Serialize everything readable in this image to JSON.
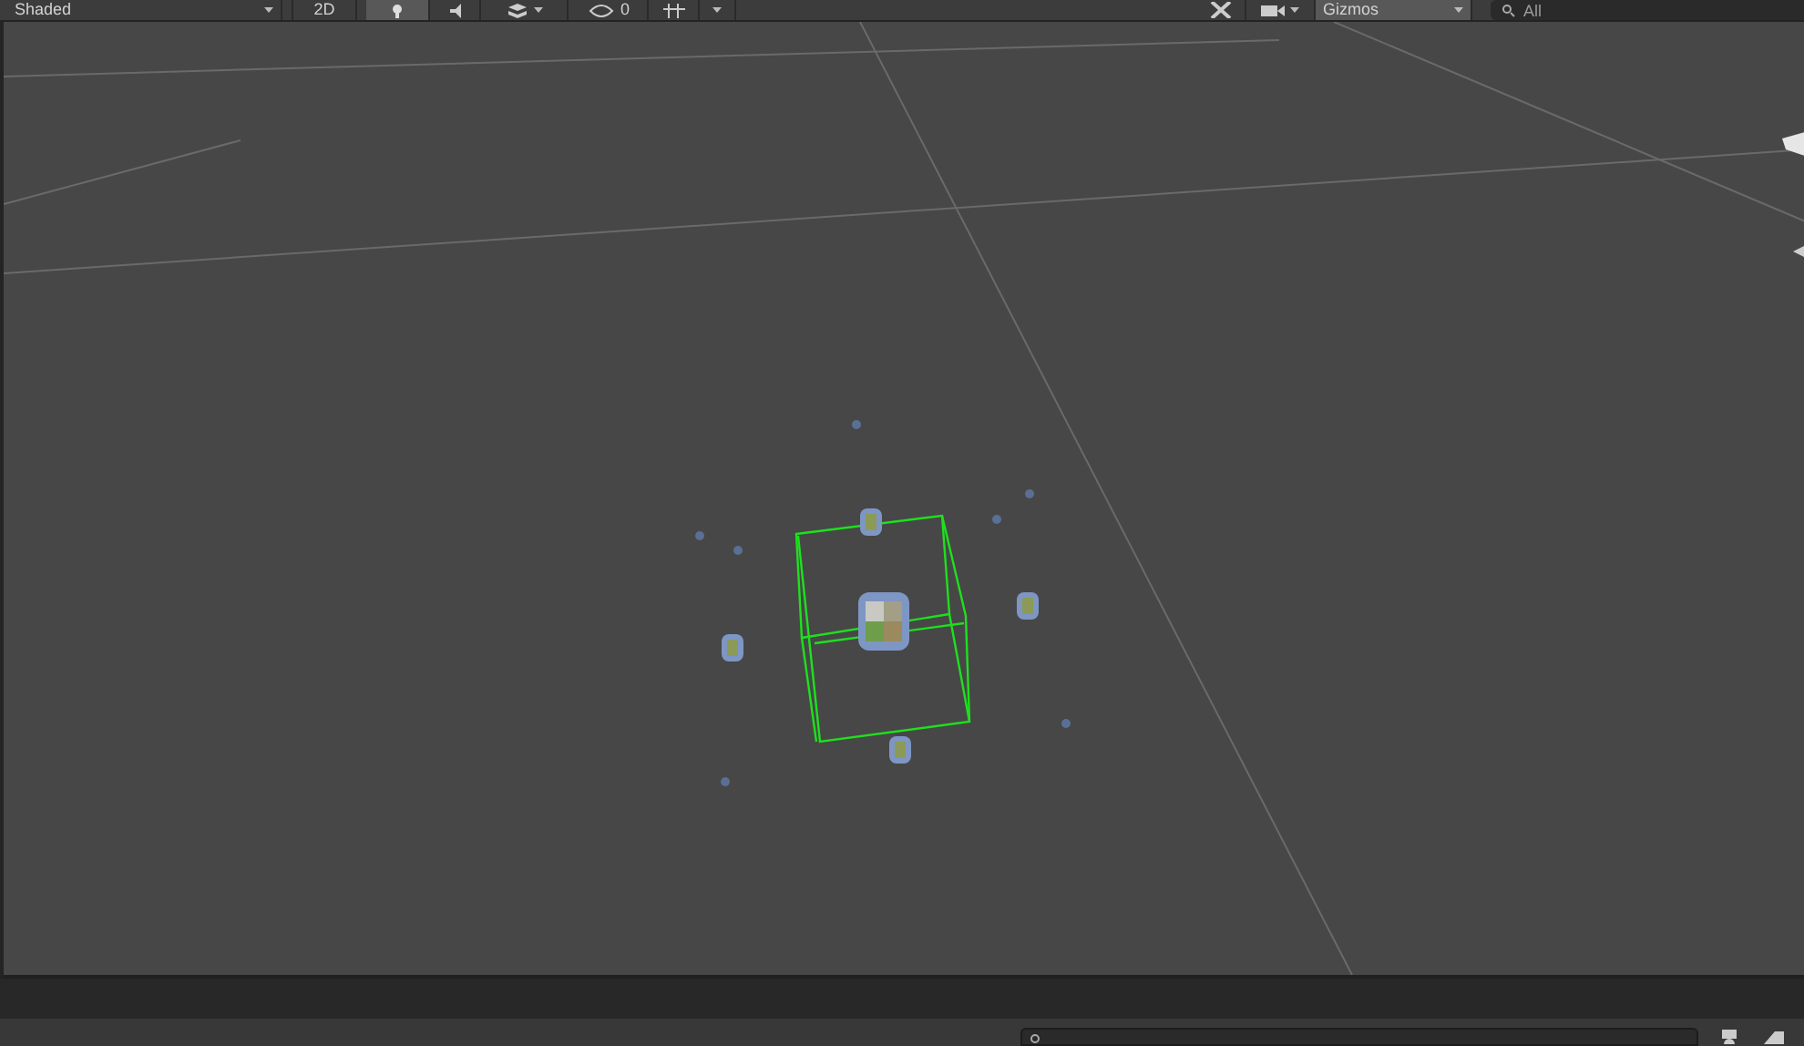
{
  "toolbar": {
    "shading_mode": "Shaded",
    "mode_2d": "2D",
    "hidden_count": "0",
    "gizmos": "Gizmos",
    "search": {
      "placeholder": "All"
    }
  }
}
